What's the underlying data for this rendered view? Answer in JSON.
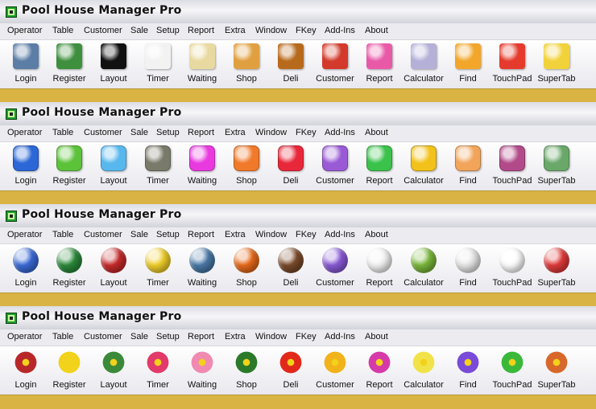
{
  "app": {
    "title": "Pool House Manager Pro"
  },
  "menu": [
    "Operator",
    "Table",
    "Customer",
    "Sale",
    "Setup",
    "Report",
    "Extra",
    "Window",
    "FKey",
    "Add-Ins",
    "About"
  ],
  "toolbar_labels": [
    "Login",
    "Register",
    "Layout",
    "Timer",
    "Waiting",
    "Shop",
    "Deli",
    "Customer",
    "Report",
    "Calculator",
    "Find",
    "TouchPad",
    "SuperTab"
  ],
  "icon_sets": [
    {
      "style": "realistic",
      "icons": [
        {
          "name": "laptop-icon",
          "color": "#5b7da6"
        },
        {
          "name": "cash-register-icon",
          "color": "#3e8f3e"
        },
        {
          "name": "eight-ball-icon",
          "color": "#111111"
        },
        {
          "name": "clock-icon",
          "color": "#f2f2f2"
        },
        {
          "name": "clipboard-icon",
          "color": "#e8d9a0"
        },
        {
          "name": "gift-box-icon",
          "color": "#e0a040"
        },
        {
          "name": "beer-mug-icon",
          "color": "#b86a1c"
        },
        {
          "name": "telephone-icon",
          "color": "#d33a2c"
        },
        {
          "name": "pink-book-icon",
          "color": "#e85aa8"
        },
        {
          "name": "calculator-icon",
          "color": "#b4b0d8"
        },
        {
          "name": "flashlight-icon",
          "color": "#f2a62a"
        },
        {
          "name": "rubiks-cube-icon",
          "color": "#e53b2c"
        },
        {
          "name": "tab-notepad-icon",
          "color": "#f1d23a"
        }
      ]
    },
    {
      "style": "glossy-buttons",
      "icons": [
        {
          "name": "power-icon",
          "color": "#2b67d6"
        },
        {
          "name": "money-bag-icon",
          "color": "#5cc23a"
        },
        {
          "name": "globe-grid-icon",
          "color": "#58b8ee"
        },
        {
          "name": "loading-icon",
          "color": "#7a7a6a"
        },
        {
          "name": "triangle-icon",
          "color": "#e83adf"
        },
        {
          "name": "chat-bubbles-icon",
          "color": "#f07a2a"
        },
        {
          "name": "music-heart-icon",
          "color": "#e8283a"
        },
        {
          "name": "people-icon",
          "color": "#9a5ad6"
        },
        {
          "name": "folder-icon",
          "color": "#3ac24a"
        },
        {
          "name": "plus-icon",
          "color": "#f2c21a"
        },
        {
          "name": "search-triangle-icon",
          "color": "#f2a45a"
        },
        {
          "name": "hand-icon",
          "color": "#b24a8a"
        },
        {
          "name": "document-icon",
          "color": "#6aa86a"
        }
      ]
    },
    {
      "style": "balls",
      "icons": [
        {
          "name": "blue-swirl-ball-icon",
          "color": "#3a6ad8"
        },
        {
          "name": "six-ball-icon",
          "color": "#2a8a3a"
        },
        {
          "name": "eleven-ball-icon",
          "color": "#c82a2a"
        },
        {
          "name": "nine-ball-icon",
          "color": "#f2cf2a"
        },
        {
          "name": "bowling-ball-icon",
          "color": "#4a7aa8"
        },
        {
          "name": "basketball-icon",
          "color": "#e86a1a"
        },
        {
          "name": "football-icon",
          "color": "#7a4a2a"
        },
        {
          "name": "twelve-ball-icon",
          "color": "#8a5ad6"
        },
        {
          "name": "baseball-icon",
          "color": "#f4f4f4"
        },
        {
          "name": "tennis-ball-icon",
          "color": "#7ab83a"
        },
        {
          "name": "golf-ball-icon",
          "color": "#e8e8e8"
        },
        {
          "name": "soccer-ball-icon",
          "color": "#ffffff"
        },
        {
          "name": "beach-ball-icon",
          "color": "#e23a3a"
        }
      ]
    },
    {
      "style": "flowers",
      "icons": [
        {
          "name": "red-mandala-flower-icon",
          "color": "#b8282a"
        },
        {
          "name": "yellow-flower-icon",
          "color": "#f2d21a"
        },
        {
          "name": "fern-leaf-icon",
          "color": "#3a8a3a"
        },
        {
          "name": "pink-dahlia-icon",
          "color": "#e23a6a"
        },
        {
          "name": "lotus-icon",
          "color": "#f08ab0"
        },
        {
          "name": "holly-icon",
          "color": "#2a7a2a"
        },
        {
          "name": "red-poppy-icon",
          "color": "#e2281a"
        },
        {
          "name": "sunflower-icon",
          "color": "#f2b21a"
        },
        {
          "name": "magenta-flower-icon",
          "color": "#d63aa8"
        },
        {
          "name": "yellow-lily-icon",
          "color": "#f2e24a"
        },
        {
          "name": "iris-icon",
          "color": "#7a4ad8"
        },
        {
          "name": "clover-icon",
          "color": "#3ab83a"
        },
        {
          "name": "maple-leaf-icon",
          "color": "#d8682a"
        }
      ]
    }
  ]
}
